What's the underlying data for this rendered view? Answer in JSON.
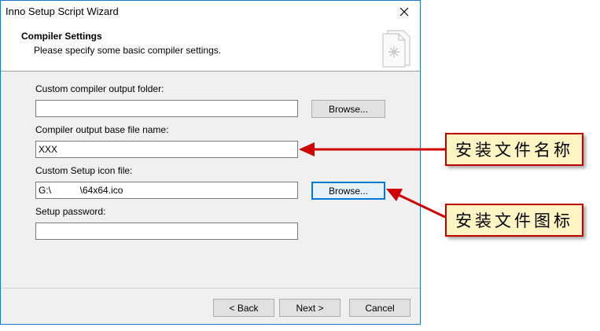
{
  "window": {
    "title": "Inno Setup Script Wizard"
  },
  "header": {
    "title": "Compiler Settings",
    "subtitle": "Please specify some basic compiler settings."
  },
  "form": {
    "output_folder_label": "Custom compiler output folder:",
    "output_folder_value": "",
    "base_name_label": "Compiler output base file name:",
    "base_name_value": "XXX",
    "icon_file_label": "Custom Setup icon file:",
    "icon_file_value": "G:\\           \\64x64.ico",
    "password_label": "Setup password:",
    "password_value": "",
    "browse_label": "Browse..."
  },
  "footer": {
    "back_label": "< Back",
    "next_label": "Next >",
    "cancel_label": "Cancel"
  },
  "annotations": {
    "callout_1": "安装文件名称",
    "callout_2": "安装文件图标",
    "arrow_color": "#d00000"
  }
}
